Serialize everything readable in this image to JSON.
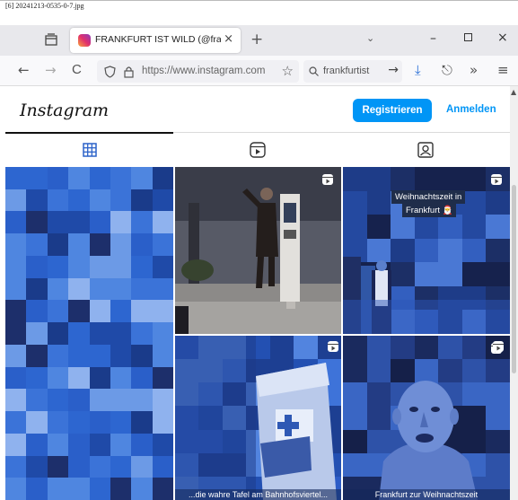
{
  "caption": "[6] 20241213-0535-0-7.jpg",
  "browser": {
    "tab_title": "FRANKFURT IST WILD (@frankfu",
    "tab_close": "×",
    "new_tab": "+",
    "tabs_menu": "⌄",
    "minimize": "–",
    "close": "×"
  },
  "nav": {
    "back": "←",
    "forward": "→",
    "reload": "C",
    "url": "https://www.instagram.com",
    "bookmark": "☆",
    "search_text": "frankfurtist",
    "search_go": "→",
    "download": "⤓",
    "share": "⎋",
    "more": "»",
    "menu": "≡"
  },
  "page": {
    "logo": "Instagram",
    "register_label": "Registrieren",
    "login_label": "Anmelden"
  },
  "posts": [
    {
      "overlay": ""
    },
    {
      "overlay": ""
    },
    {
      "overlay_line1": "Weihnachtszeit in",
      "overlay_line2": "Frankfurt 🎅"
    },
    {
      "caption": "...die wahre Tafel am Bahnhofsviertel..."
    },
    {
      "caption": "Frankfurt zur Weihnachtszeit"
    }
  ],
  "colors": {
    "accent": "#0095f6",
    "tint": "#2b62c9"
  }
}
